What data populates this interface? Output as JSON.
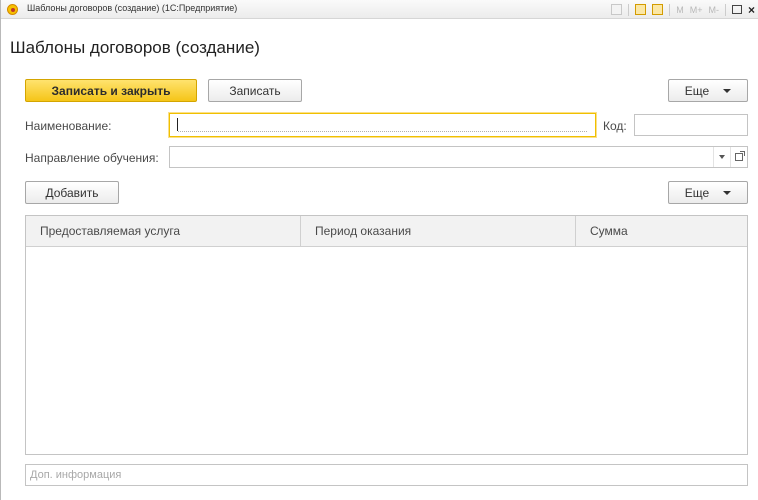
{
  "window": {
    "title": "Шаблоны договоров (создание)  (1С:Предприятие)",
    "toolbar_m_labels": [
      "M",
      "M+",
      "M-"
    ],
    "close_glyph": "×"
  },
  "page": {
    "title": "Шаблоны договоров (создание)"
  },
  "command_bar": {
    "save_close_label": "Записать и закрыть",
    "save_label": "Записать",
    "more_label": "Еще"
  },
  "form": {
    "name_label": "Наименование:",
    "name_value": "",
    "code_label": "Код:",
    "code_value": "",
    "direction_label": "Направление обучения:",
    "direction_value": ""
  },
  "table_bar": {
    "add_label": "Добавить",
    "more_label": "Еще"
  },
  "table": {
    "columns": [
      "Предоставляемая услуга",
      "Период оказания",
      "Сумма"
    ],
    "rows": []
  },
  "notes": {
    "placeholder": "Доп. информация"
  },
  "colors": {
    "primary_button": "#f5c518",
    "focus_border": "#f0c000"
  }
}
